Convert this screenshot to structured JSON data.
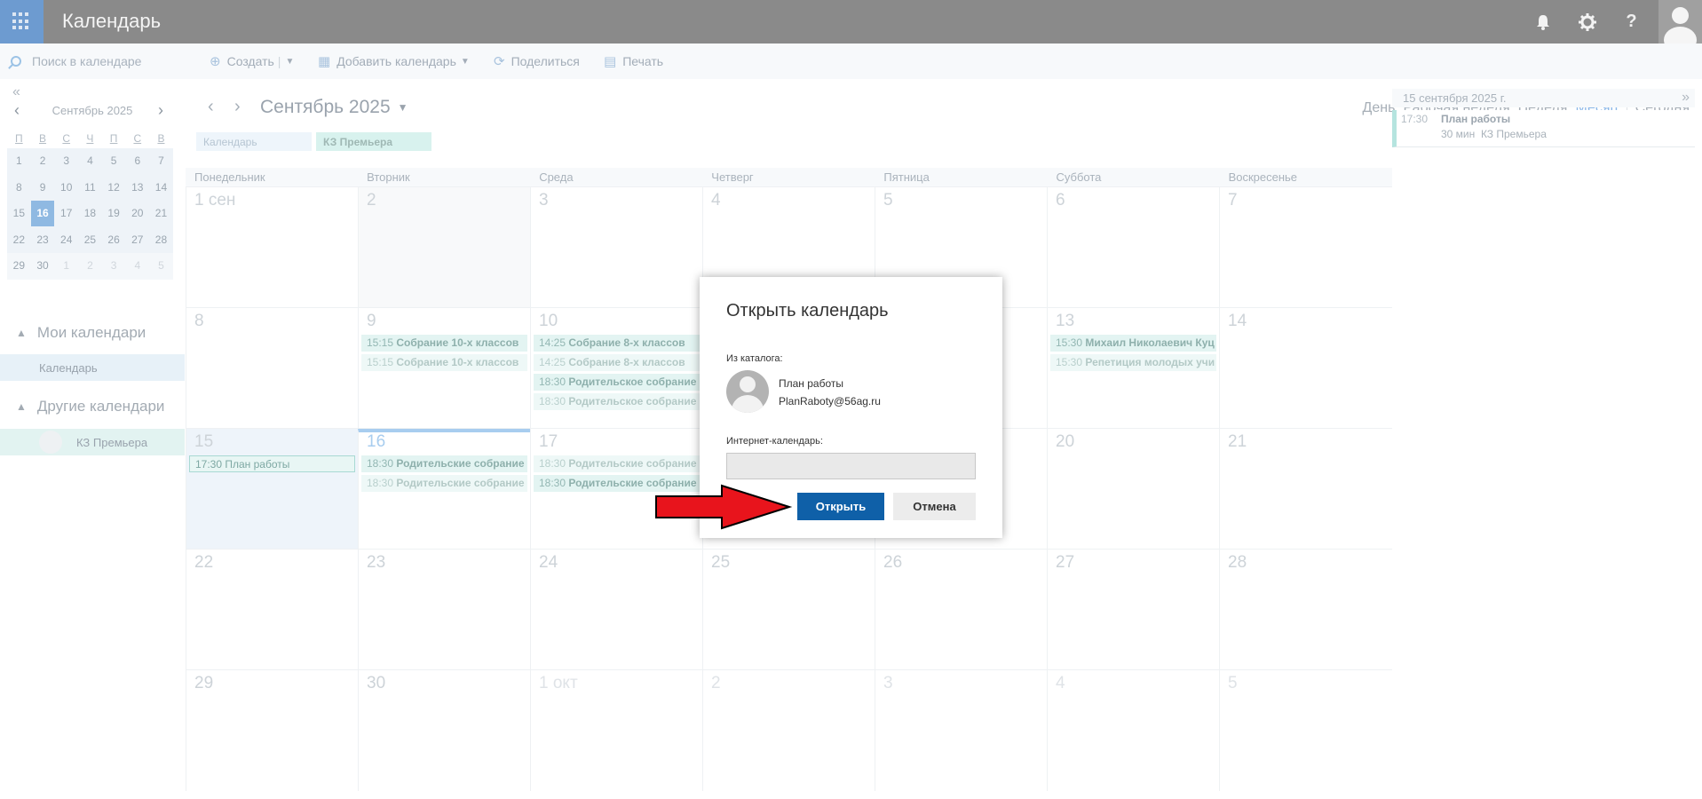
{
  "header": {
    "app_title": "Календарь",
    "icons": [
      "app-launcher-icon",
      "bell-icon",
      "gear-icon",
      "help-icon",
      "user-avatar"
    ]
  },
  "toolbar": {
    "search_placeholder": "Поиск в календаре",
    "create_label": "Создать",
    "add_calendar_label": "Добавить календарь",
    "share_label": "Поделиться",
    "print_label": "Печать"
  },
  "sidebar": {
    "mini_calendar": {
      "title": "Сентябрь 2025",
      "weekdays": [
        "П",
        "В",
        "С",
        "Ч",
        "П",
        "С",
        "В"
      ],
      "weeks": [
        [
          "1",
          "2",
          "3",
          "4",
          "5",
          "6",
          "7"
        ],
        [
          "8",
          "9",
          "10",
          "11",
          "12",
          "13",
          "14"
        ],
        [
          "15",
          "16",
          "17",
          "18",
          "19",
          "20",
          "21"
        ],
        [
          "22",
          "23",
          "24",
          "25",
          "26",
          "27",
          "28"
        ],
        [
          "29",
          "30",
          "1",
          "2",
          "3",
          "4",
          "5"
        ]
      ],
      "today": "16"
    },
    "my_calendars_title": "Мои календари",
    "my_calendars": [
      "Календарь"
    ],
    "other_calendars_title": "Другие календари",
    "other_calendars": [
      "КЗ Премьера"
    ]
  },
  "main": {
    "month_title": "Сентябрь 2025",
    "views": [
      "День",
      "Рабочая неделя",
      "Неделя",
      "Месяц"
    ],
    "active_view": "Месяц",
    "today_label": "Сегодня",
    "calendar_chips": [
      "Календарь",
      "КЗ Премьера"
    ],
    "day_headers": [
      "Понедельник",
      "Вторник",
      "Среда",
      "Четверг",
      "Пятница",
      "Суббота",
      "Воскресенье"
    ],
    "weeks": [
      [
        "1 сен",
        "2",
        "3",
        "4",
        "5",
        "6",
        "7"
      ],
      [
        "8",
        "9",
        "10",
        "11",
        "12",
        "13",
        "14"
      ],
      [
        "15",
        "16",
        "17",
        "18",
        "19",
        "20",
        "21"
      ],
      [
        "22",
        "23",
        "24",
        "25",
        "26",
        "27",
        "28"
      ],
      [
        "29",
        "30",
        "1 окт",
        "2",
        "3",
        "4",
        "5"
      ]
    ],
    "events": {
      "tue9_a": {
        "time": "15:15",
        "title": "Собрание 10-х классов"
      },
      "tue9_b": {
        "time": "15:15",
        "title": "Собрание 10-х классов"
      },
      "wed10_a": {
        "time": "14:25",
        "title": "Собрание 8-х классов"
      },
      "wed10_b": {
        "time": "14:25",
        "title": "Собрание 8-х классов"
      },
      "wed10_c": {
        "time": "18:30",
        "title": "Родительское собрание"
      },
      "wed10_d": {
        "time": "18:30",
        "title": "Родительское собрание"
      },
      "sat13_a": {
        "time": "15:30",
        "title": "Михаил Николаевич Куц"
      },
      "sat13_b": {
        "time": "15:30",
        "title": "Репетиция молодых учи"
      },
      "mon15_a": {
        "time": "17:30",
        "title": "План работы"
      },
      "tue16_a": {
        "time": "18:30",
        "title": "Родительские собрание"
      },
      "tue16_b": {
        "time": "18:30",
        "title": "Родительские собрание"
      },
      "wed17_a": {
        "time": "18:30",
        "title": "Родительские собрание"
      },
      "wed17_b": {
        "time": "18:30",
        "title": "Родительские собрание"
      }
    }
  },
  "agenda": {
    "date": "15 сентября 2025 г.",
    "event": {
      "time": "17:30",
      "title": "План работы",
      "duration": "30 мин",
      "calendar": "КЗ Премьера"
    }
  },
  "dialog": {
    "title": "Открыть календарь",
    "directory_label": "Из каталога:",
    "entry_name": "План работы",
    "entry_email": "PlanRaboty@56ag.ru",
    "internet_label": "Интернет-календарь:",
    "internet_value": "",
    "open_button": "Открыть",
    "cancel_button": "Отмена"
  },
  "colors": {
    "accent": "#0f60a8",
    "arrow": "#e8141c",
    "topbar": "#8a8a8a",
    "launcher": "#6d9bd0"
  }
}
